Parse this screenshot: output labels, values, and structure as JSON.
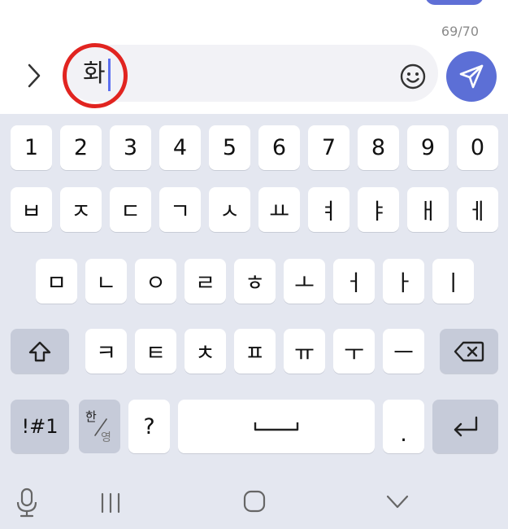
{
  "composer": {
    "char_counter": "69/70",
    "input_text": "화",
    "colors": {
      "send_button": "#5c6fd6",
      "cursor": "#5b6ff0",
      "highlight_circle": "#e12420"
    }
  },
  "keyboard": {
    "number_row": [
      "1",
      "2",
      "3",
      "4",
      "5",
      "6",
      "7",
      "8",
      "9",
      "0"
    ],
    "row1": [
      "ㅂ",
      "ㅈ",
      "ㄷ",
      "ㄱ",
      "ㅅ",
      "ㅛ",
      "ㅕ",
      "ㅑ",
      "ㅐ",
      "ㅔ"
    ],
    "row2": [
      "ㅁ",
      "ㄴ",
      "ㅇ",
      "ㄹ",
      "ㅎ",
      "ㅗ",
      "ㅓ",
      "ㅏ",
      "ㅣ"
    ],
    "row3": [
      "ㅋ",
      "ㅌ",
      "ㅊ",
      "ㅍ",
      "ㅠ",
      "ㅜ",
      "ㅡ"
    ],
    "symbols_label": "!#1",
    "hangul_label": "한",
    "english_label": "영",
    "question_label": "?",
    "period_label": ".",
    "icons": {
      "shift": "shift-icon",
      "backspace": "backspace-icon",
      "enter": "enter-icon",
      "space": "space-icon"
    }
  },
  "navbar": {
    "icons": [
      "microphone-icon",
      "recent-apps-icon",
      "home-icon",
      "hide-keyboard-icon"
    ]
  }
}
